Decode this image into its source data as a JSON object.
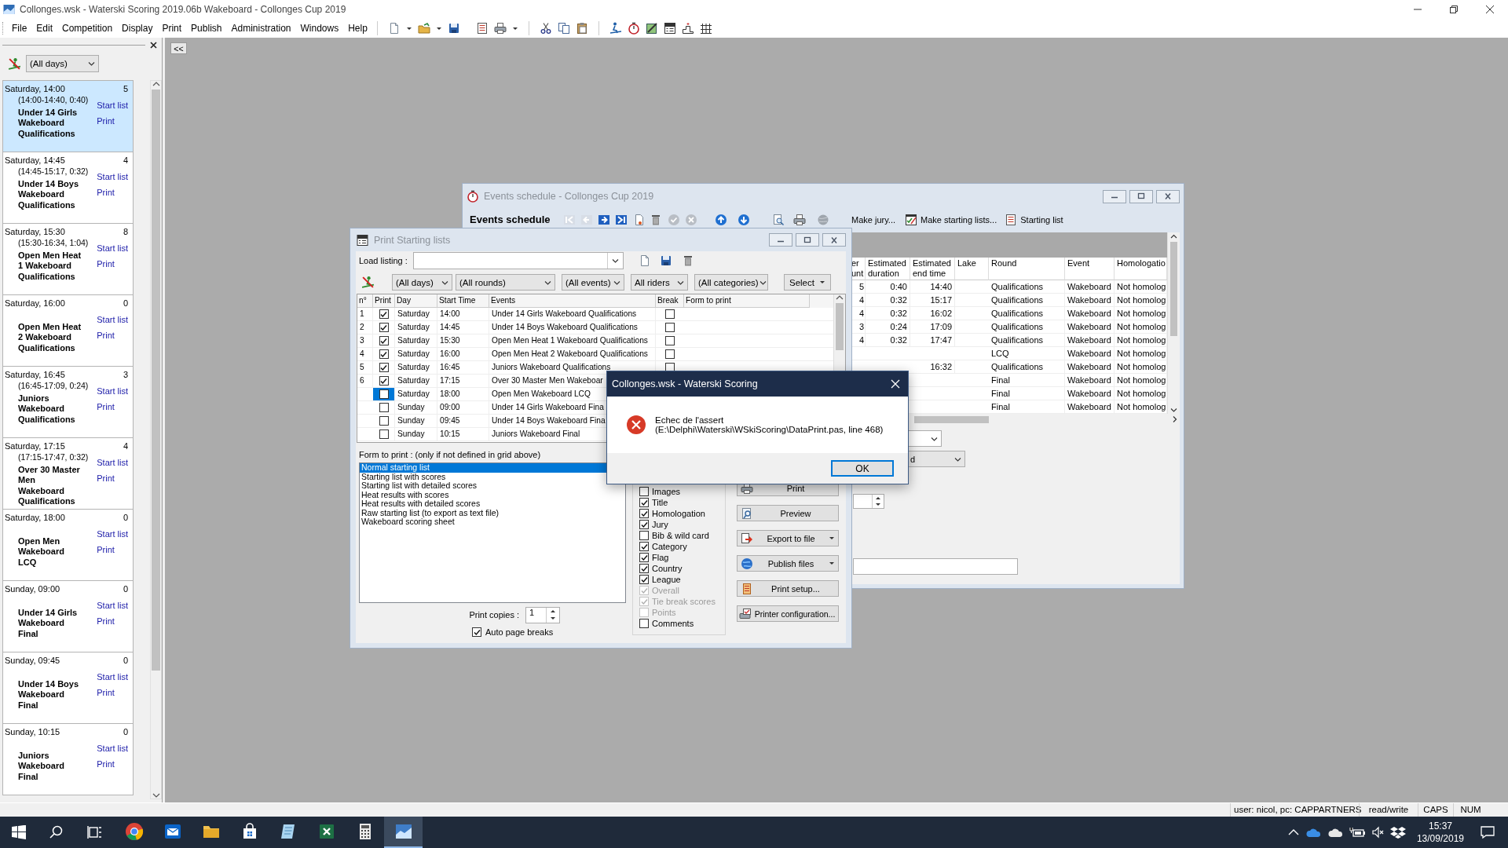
{
  "window": {
    "title": "Collonges.wsk - Waterski Scoring 2019.06b Wakeboard - Collonges Cup 2019"
  },
  "menu": [
    "File",
    "Edit",
    "Competition",
    "Display",
    "Print",
    "Publish",
    "Administration",
    "Windows",
    "Help"
  ],
  "sidebar": {
    "day_filter": "(All days)",
    "events": [
      {
        "when": "Saturday, 14:00",
        "count": "5",
        "range": "(14:00-14:40, 0:40)",
        "name": "Under 14 Girls Wakeboard Qualifications",
        "start_link": "Start list",
        "print_link": "Print",
        "selected": true
      },
      {
        "when": "Saturday, 14:45",
        "count": "4",
        "range": "(14:45-15:17, 0:32)",
        "name": "Under 14 Boys Wakeboard Qualifications",
        "start_link": "Start list",
        "print_link": "Print",
        "selected": false
      },
      {
        "when": "Saturday, 15:30",
        "count": "8",
        "range": "(15:30-16:34, 1:04)",
        "name": "Open Men Heat 1 Wakeboard Qualifications",
        "start_link": "Start list",
        "print_link": "Print",
        "selected": false
      },
      {
        "when": "Saturday, 16:00",
        "count": "0",
        "name": "Open Men Heat 2 Wakeboard Qualifications",
        "start_link": "Start list",
        "print_link": "Print",
        "selected": false
      },
      {
        "when": "Saturday, 16:45",
        "count": "3",
        "range": "(16:45-17:09, 0:24)",
        "name": "Juniors Wakeboard Qualifications",
        "start_link": "Start list",
        "print_link": "Print",
        "selected": false
      },
      {
        "when": "Saturday, 17:15",
        "count": "4",
        "range": "(17:15-17:47, 0:32)",
        "name": "Over 30 Master Men Wakeboard Qualifications",
        "start_link": "Start list",
        "print_link": "Print",
        "selected": false
      },
      {
        "when": "Saturday, 18:00",
        "count": "0",
        "name": "Open Men Wakeboard LCQ",
        "start_link": "Start list",
        "print_link": "Print",
        "selected": false
      },
      {
        "when": "Sunday, 09:00",
        "count": "0",
        "name": "Under 14 Girls Wakeboard Final",
        "start_link": "Start list",
        "print_link": "Print",
        "selected": false
      },
      {
        "when": "Sunday, 09:45",
        "count": "0",
        "name": "Under 14 Boys Wakeboard Final",
        "start_link": "Start list",
        "print_link": "Print",
        "selected": false
      },
      {
        "when": "Sunday, 10:15",
        "count": "0",
        "name": "Juniors Wakeboard Final",
        "start_link": "Start list",
        "print_link": "Print",
        "selected": false
      }
    ]
  },
  "collapse_button": "<<",
  "schedule_window": {
    "title": "Events schedule - Collonges Cup 2019",
    "heading": "Events schedule",
    "actions": [
      {
        "label": "Make jury...",
        "kind": "text"
      },
      {
        "label": "Make starting lists...",
        "kind": "checklist"
      },
      {
        "label": "Starting list",
        "kind": "list"
      }
    ],
    "columns": [
      {
        "lines": [
          "er",
          "unt"
        ]
      },
      {
        "lines": [
          "Estimated",
          "duration"
        ]
      },
      {
        "lines": [
          "Estimated",
          "end time"
        ]
      },
      {
        "lines": [
          "Lake"
        ]
      },
      {
        "lines": [
          "Round"
        ]
      },
      {
        "lines": [
          "Event"
        ]
      },
      {
        "lines": [
          "Homologatio"
        ]
      }
    ],
    "rows": [
      {
        "column_1": "5",
        "duration": "0:40",
        "end_time": "14:40",
        "round": "Qualifications",
        "event": "Wakeboard",
        "homologation": "Not homolog"
      },
      {
        "column_1": "4",
        "duration": "0:32",
        "end_time": "15:17",
        "round": "Qualifications",
        "event": "Wakeboard",
        "homologation": "Not homolog"
      },
      {
        "column_1": "4",
        "duration": "0:32",
        "end_time": "16:02",
        "round": "Qualifications",
        "event": "Wakeboard",
        "homologation": "Not homolog"
      },
      {
        "column_1": "3",
        "duration": "0:24",
        "end_time": "17:09",
        "round": "Qualifications",
        "event": "Wakeboard",
        "homologation": "Not homolog"
      },
      {
        "column_1": "4",
        "duration": "0:32",
        "end_time": "17:47",
        "round": "Qualifications",
        "event": "Wakeboard",
        "homologation": "Not homolog"
      },
      {
        "round": "LCQ",
        "event": "Wakeboard",
        "homologation": "Not homolog"
      },
      {
        "end_time": "16:32",
        "round": "Qualifications",
        "event": "Wakeboard",
        "homologation": "Not homolog"
      },
      {
        "round": "Final",
        "event": "Wakeboard",
        "homologation": "Not homolog"
      },
      {
        "round": "Final",
        "event": "Wakeboard",
        "homologation": "Not homolog"
      },
      {
        "round": "Final",
        "event": "Wakeboard",
        "homologation": "Not homolog"
      }
    ],
    "combo_value": "d"
  },
  "print_window": {
    "title": "Print Starting lists",
    "load_label": "Load listing :",
    "filters": [
      "(All days)",
      "(All rounds)",
      "(All events)",
      "All riders",
      "(All categories)"
    ],
    "select_button": "Select",
    "columns": [
      "n°",
      "Print",
      "Day",
      "Start Time",
      "Events",
      "Break",
      "Form to print"
    ],
    "rows": [
      {
        "n": "1",
        "print": true,
        "day": "Saturday",
        "time": "14:00",
        "event": "Under 14 Girls Wakeboard Qualifications",
        "break": false,
        "focused": false
      },
      {
        "n": "2",
        "print": true,
        "day": "Saturday",
        "time": "14:45",
        "event": "Under 14 Boys Wakeboard Qualifications",
        "break": false,
        "focused": false
      },
      {
        "n": "3",
        "print": true,
        "day": "Saturday",
        "time": "15:30",
        "event": "Open Men Heat 1 Wakeboard Qualifications",
        "break": false,
        "focused": false
      },
      {
        "n": "4",
        "print": true,
        "day": "Saturday",
        "time": "16:00",
        "event": "Open Men Heat 2 Wakeboard Qualifications",
        "break": false,
        "focused": false
      },
      {
        "n": "5",
        "print": true,
        "day": "Saturday",
        "time": "16:45",
        "event": "Juniors Wakeboard Qualifications",
        "break": false,
        "focused": false
      },
      {
        "n": "6",
        "print": true,
        "day": "Saturday",
        "time": "17:15",
        "event": "Over 30 Master Men Wakeboar",
        "focused": false
      },
      {
        "print": false,
        "day": "Saturday",
        "time": "18:00",
        "event": "Open Men Wakeboard LCQ",
        "focused": true
      },
      {
        "print": false,
        "day": "Sunday",
        "time": "09:00",
        "event": "Under 14 Girls Wakeboard Fina",
        "focused": false
      },
      {
        "print": false,
        "day": "Sunday",
        "time": "09:45",
        "event": "Under 14 Boys Wakeboard Fina",
        "focused": false
      },
      {
        "print": false,
        "day": "Sunday",
        "time": "10:15",
        "event": "Juniors Wakeboard Final",
        "focused": false
      }
    ],
    "form_label": "Form to print : (only if not defined in grid above)",
    "forms": [
      {
        "label": "Normal starting list",
        "selected": true
      },
      {
        "label": "Starting list with scores",
        "selected": false
      },
      {
        "label": "Starting list with detailed scores",
        "selected": false
      },
      {
        "label": "Heat results with scores",
        "selected": false
      },
      {
        "label": "Heat results with detailed scores",
        "selected": false
      },
      {
        "label": "Raw starting list (to export as text file)",
        "selected": false
      },
      {
        "label": "Wakeboard scoring sheet",
        "selected": false
      }
    ],
    "copies_label": "Print copies :",
    "copies": "1",
    "auto_breaks": {
      "label": "Auto page breaks",
      "checked": true
    },
    "options": [
      {
        "label": "Images",
        "checked": false,
        "disabled": false
      },
      {
        "label": "Title",
        "checked": true,
        "disabled": false
      },
      {
        "label": "Homologation",
        "checked": true,
        "disabled": false
      },
      {
        "label": "Jury",
        "checked": true,
        "disabled": false
      },
      {
        "label": "Bib & wild card",
        "checked": false,
        "disabled": false
      },
      {
        "label": "Category",
        "checked": true,
        "disabled": false
      },
      {
        "label": "Flag",
        "checked": true,
        "disabled": false
      },
      {
        "label": "Country",
        "checked": true,
        "disabled": false
      },
      {
        "label": "League",
        "checked": true,
        "disabled": false
      },
      {
        "label": "Overall",
        "checked": true,
        "disabled": true
      },
      {
        "label": "Tie break scores",
        "checked": true,
        "disabled": true
      },
      {
        "label": "Points",
        "checked": false,
        "disabled": true
      },
      {
        "label": "Comments",
        "checked": false,
        "disabled": false
      }
    ],
    "buttons": [
      {
        "label": "Print",
        "kind": "print",
        "menu": false
      },
      {
        "label": "Preview",
        "kind": "preview",
        "menu": false
      },
      {
        "label": "Export to file",
        "kind": "export",
        "menu": true
      },
      {
        "label": "Publish files",
        "kind": "publish",
        "menu": true
      },
      {
        "label": "Print setup...",
        "kind": "setup",
        "menu": false
      },
      {
        "label": "Printer configuration...",
        "kind": "config",
        "menu": false
      }
    ]
  },
  "dialog": {
    "title": "Collonges.wsk - Waterski Scoring",
    "message": [
      "Echec de l'assert",
      "(E:\\Delphi\\Waterski\\WSkiScoring\\DataPrint.pas, line 468)"
    ],
    "ok": "OK"
  },
  "status_bar": [
    "user: nicol, pc: CAPPARTNERS",
    "read/write",
    "CAPS",
    "NUM"
  ],
  "taskbar": {
    "apps": [
      {
        "kind": "browser",
        "active": false
      },
      {
        "kind": "mail",
        "active": false
      },
      {
        "kind": "files",
        "active": false
      },
      {
        "kind": "store",
        "active": false
      },
      {
        "kind": "notes",
        "active": false
      },
      {
        "kind": "sheet",
        "active": false
      },
      {
        "kind": "calc",
        "active": false
      },
      {
        "kind": "app",
        "active": true
      }
    ],
    "time": "15:37",
    "date": "13/09/2019"
  }
}
